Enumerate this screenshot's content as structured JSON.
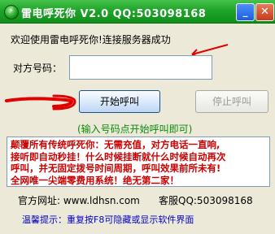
{
  "window": {
    "title": "雷电呼死你 V2.0 QQ:503098168",
    "minimize_glyph": "_",
    "close_glyph": "✕"
  },
  "status": {
    "message": "欢迎使用雷电呼死你!连接服务器成功"
  },
  "form": {
    "phone_label": "对方号码：",
    "phone_value": "",
    "phone_placeholder": ""
  },
  "buttons": {
    "start_label": "开始呼叫",
    "stop_label": "停止呼叫"
  },
  "hint": "(输入号码点开始呼叫即可)",
  "ad": {
    "lines": [
      "颠覆所有传统呼死你：无需充值，对方电话一直响,",
      "接听即自动秒挂！什么时候挂断就什么时候自动再次",
      "呼叫，并无固定拨号时间周期，呼叫效果前所未有!",
      "全网唯一尖端零费用系统！绝无第二家！"
    ]
  },
  "contact": {
    "website": "官方网址: www.ldhsn.com",
    "qq": "客服QQ:503098168"
  },
  "footer": {
    "tip": "温馨提示：重复按F8可隐藏或显示软件界面"
  },
  "colors": {
    "titlebar": "#20a42a",
    "ad_text": "#cc0000",
    "hint_text": "#0a8a0a",
    "footer_text": "#0000cc",
    "annotation_red": "#e00000"
  },
  "icons": {
    "app": "lightning-app-icon",
    "minimize": "minimize-icon",
    "close": "close-icon"
  }
}
